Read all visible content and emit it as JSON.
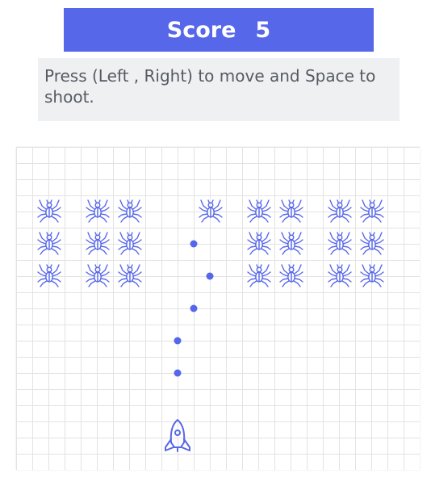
{
  "score": {
    "label": "Score",
    "value": "5"
  },
  "instructions": {
    "text": "Press (Left , Right) to move and Space to shoot."
  },
  "board": {
    "columns": 25,
    "rows": 20,
    "cell_size": 20,
    "grid_color": "#e3e3e3",
    "accent_color": "#5767ea",
    "enemy_icon": "spider-icon",
    "player_icon": "rocket-icon",
    "enemies": [
      {
        "col": 2,
        "row": 4
      },
      {
        "col": 5,
        "row": 4
      },
      {
        "col": 7,
        "row": 4
      },
      {
        "col": 12,
        "row": 4
      },
      {
        "col": 15,
        "row": 4
      },
      {
        "col": 17,
        "row": 4
      },
      {
        "col": 20,
        "row": 4
      },
      {
        "col": 22,
        "row": 4
      },
      {
        "col": 2,
        "row": 6
      },
      {
        "col": 5,
        "row": 6
      },
      {
        "col": 7,
        "row": 6
      },
      {
        "col": 15,
        "row": 6
      },
      {
        "col": 17,
        "row": 6
      },
      {
        "col": 20,
        "row": 6
      },
      {
        "col": 22,
        "row": 6
      },
      {
        "col": 2,
        "row": 8
      },
      {
        "col": 5,
        "row": 8
      },
      {
        "col": 7,
        "row": 8
      },
      {
        "col": 15,
        "row": 8
      },
      {
        "col": 17,
        "row": 8
      },
      {
        "col": 20,
        "row": 8
      },
      {
        "col": 22,
        "row": 8
      }
    ],
    "bullets": [
      {
        "col": 11,
        "row": 6
      },
      {
        "col": 12,
        "row": 8
      },
      {
        "col": 11,
        "row": 10
      },
      {
        "col": 10,
        "row": 12
      },
      {
        "col": 10,
        "row": 14
      }
    ],
    "player": {
      "col": 10,
      "row": 18
    }
  }
}
